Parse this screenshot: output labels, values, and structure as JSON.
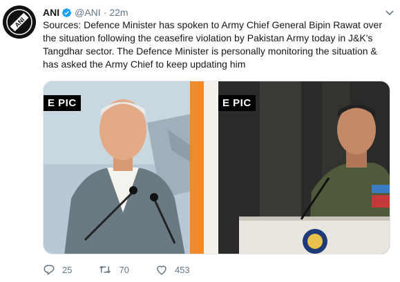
{
  "tweet": {
    "author": {
      "display_name": "ANI",
      "handle": "@ANI",
      "verified": true,
      "avatar_label": "ANI"
    },
    "separator": "·",
    "time": "22m",
    "text": "Sources: Defence Minister has spoken to Army Chief General Bipin Rawat over the situation following the ceasefire violation by Pakistan Army today in J&K's Tangdhar sector. The Defence Minister is personally monitoring the situation & has asked the Army Chief to keep updating him",
    "media": [
      {
        "caption": "E PIC",
        "icon": "defence-minister-photo"
      },
      {
        "caption": "E PIC",
        "icon": "army-chief-photo"
      }
    ],
    "actions": {
      "replies": "25",
      "retweets": "70",
      "likes": "453"
    }
  },
  "colors": {
    "text": "#14171a",
    "secondary": "#657786",
    "verified_blue": "#1da1f2"
  }
}
